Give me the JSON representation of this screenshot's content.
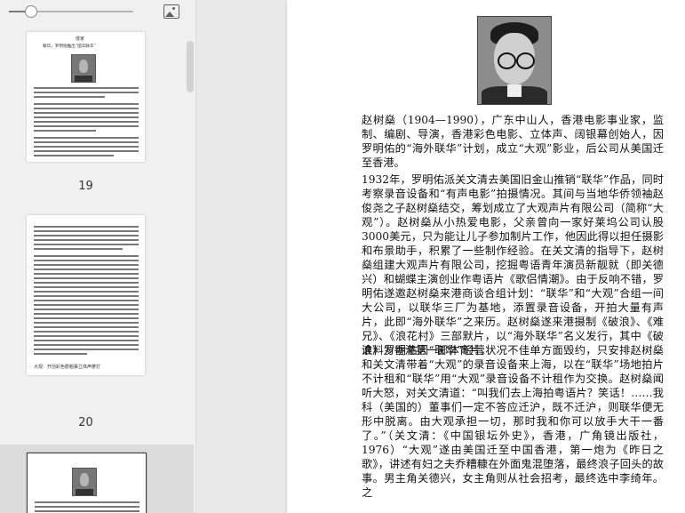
{
  "toolbar": {
    "zoom_fraction": 0.18,
    "image_icon": "image-icon"
  },
  "thumbnails": [
    {
      "page_number": "19",
      "lines": [
        "侵家",
        "联华，罗明佑推出“国华联华”",
        "大观：开创彩色剧粗摹立体声摩打"
      ]
    },
    {
      "page_number": "20",
      "lines": [
        "大观：开创彩色剧粗摹立体声摩打"
      ]
    }
  ],
  "document": {
    "paragraphs": [
      "赵树燊（1904—1990），广东中山人，香港电影事业家，监制、编剧、导演，香港彩色电影、立体声、阔银幕创始人，因罗明佑的“海外联华”计划，成立“大观”影业，后公司从美国迁至香港。",
      "1932年，罗明佑派关文清去美国旧金山推销“联华”作品，同时考察录音设备和“有声电影”拍摄情况。其间与当地华侨领袖赵俊尧之子赵树燊结交，筹划成立了大观声片有限公司（简称“大观”）。赵树燊从小热爱电影，父亲曾向一家好莱坞公司认股3000美元，只为能让儿子参加制片工作，他因此得以担任摄影和布景助手，积累了一些制作经验。在关文清的指导下，赵树燊组建大观声片有限公司，挖掘粤语青年演员新靓就（即关德兴）和蝴蝶主演创业作粤语片《歌侣情潮》。由于反响不错，罗明佑遂邀赵树燊来港商谈合组计划：“联华”和“大观”合组一间大公司，以联华三厂为基地，添置录音设备，开拍大量有声片，此即“海外联华”之来历。赵树燊遂来港摄制《破浪》、《难兄》、《浪花村》三部默片，以“海外联华”名义发行，其中《破浪》为香港第一部体育片。",
      "谁料罗明佑因“联华”经营状况不佳单方面毁约，只安排赵树燊和关文清带着“大观”的录音设备来上海，以在“联华”场地拍片不计租和“联华”用“大观”录音设备不计租作为交换。赵树燊闻听大怒，对关文清道：“叫我们去上海拍粤语片？笑话！……我科（美国的）董事们一定不答应迁沪，既不迁沪，则联华便无形中脱离。由大观承担一切，那时我和你可以放手大干一番了。”（关文清：《中国银坛外史》，香港，广角镜出版社，1976）“大观”遂由美国迁至中国香港，第一炮为《昨日之歌》，讲述有妇之夫乔糟糠在外面鬼混堕落，最终浪子回头的故事。男主角关德兴，女主角则从社会招考，最终选中李绮年。之"
    ]
  }
}
